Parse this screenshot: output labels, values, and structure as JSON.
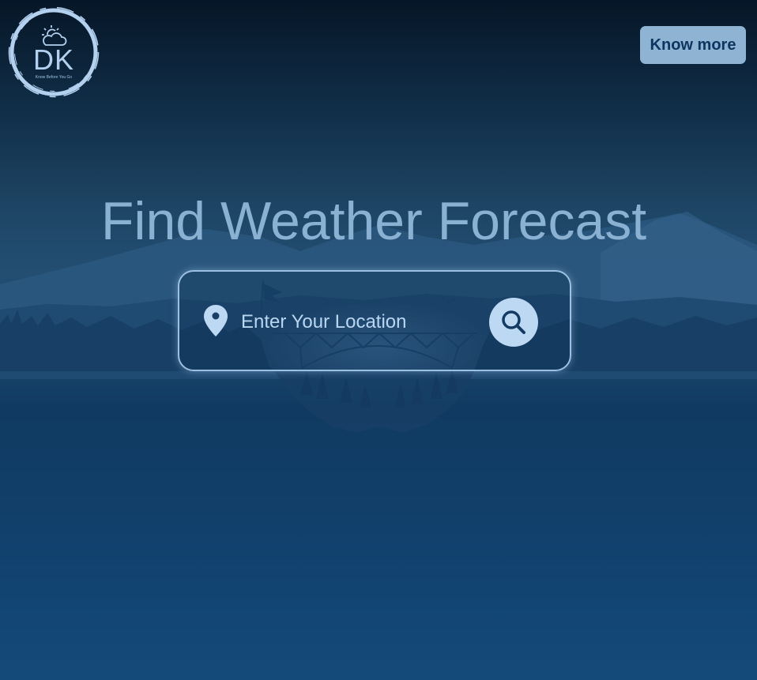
{
  "logo": {
    "letters": "DK",
    "tagline": "Know Before You Go",
    "icon": "sun-cloud-icon"
  },
  "header": {
    "know_more_label": "Know more"
  },
  "hero": {
    "title": "Find Weather Forecast"
  },
  "search": {
    "placeholder": "Enter Your Location",
    "value": "",
    "location_icon": "map-pin-icon",
    "button_icon": "search-icon"
  },
  "colors": {
    "accent": "#8fb3d3",
    "button_text": "#0d3560",
    "title": "#8bb1d2",
    "input_text": "#b9d6f2"
  }
}
